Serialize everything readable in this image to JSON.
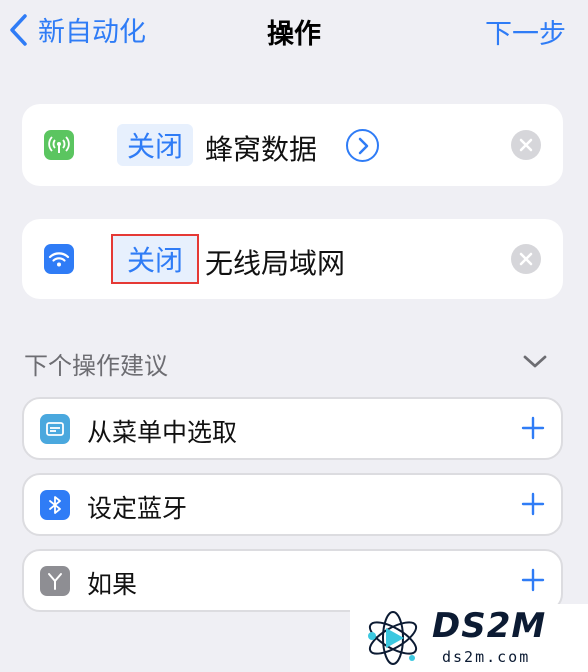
{
  "nav": {
    "back_label": "新自动化",
    "title": "操作",
    "next_label": "下一步"
  },
  "actions": [
    {
      "icon": "cellular-icon",
      "token": "关闭",
      "text": "蜂窝数据"
    },
    {
      "icon": "wifi-icon",
      "token": "关闭",
      "text": "无线局域网"
    }
  ],
  "suggestions": {
    "header": "下个操作建议",
    "items": [
      {
        "icon": "menu-icon",
        "label": "从菜单中选取"
      },
      {
        "icon": "bluetooth-icon",
        "label": "设定蓝牙"
      },
      {
        "icon": "branch-icon",
        "label": "如果"
      }
    ]
  },
  "watermark": {
    "brand": "DS2M",
    "url": "ds2m.com"
  },
  "colors": {
    "accent": "#2f7cf6",
    "background": "#efeff4",
    "highlight_border": "#e53935"
  }
}
